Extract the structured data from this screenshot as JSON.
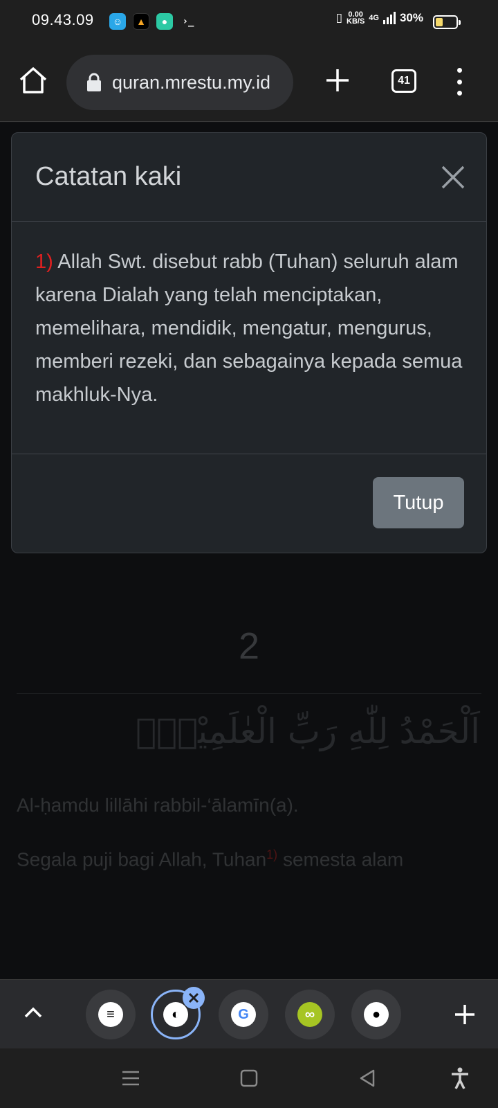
{
  "status_bar": {
    "time": "09.43.09",
    "prompt_glyph": "›_",
    "speed_value": "0.00",
    "speed_unit": "KB/S",
    "network": "4G",
    "battery_percent": "30%",
    "battery_level": 0.3
  },
  "browser": {
    "url": "quran.mrestu.my.id",
    "tab_count": "41"
  },
  "modal": {
    "title": "Catatan kaki",
    "footnote_number": "1)",
    "footnote_text": "Allah Swt. disebut rabb (Tuhan) seluruh alam karena Dialah yang telah menciptakan, memelihara, mendidik, mengatur, mengurus, memberi rezeki, dan sebagainya kepada semua makhluk-Nya.",
    "close_button_label": "Tutup"
  },
  "ayah": {
    "number": "2",
    "arabic": "اَلْحَمْدُ لِلّٰهِ رَبِّ الْعٰلَمِيْنَۙ",
    "transliteration": "Al-ḥamdu lillāhi rabbil-‘ālamīn(a).",
    "translation_before": "Segala puji bagi Allah, Tuhan",
    "translation_footnote": "1)",
    "translation_after": " semesta alam"
  },
  "colors": {
    "accent_blue": "#8ab4f8",
    "footnote_red": "#e02020",
    "button_gray": "#6c757d"
  }
}
